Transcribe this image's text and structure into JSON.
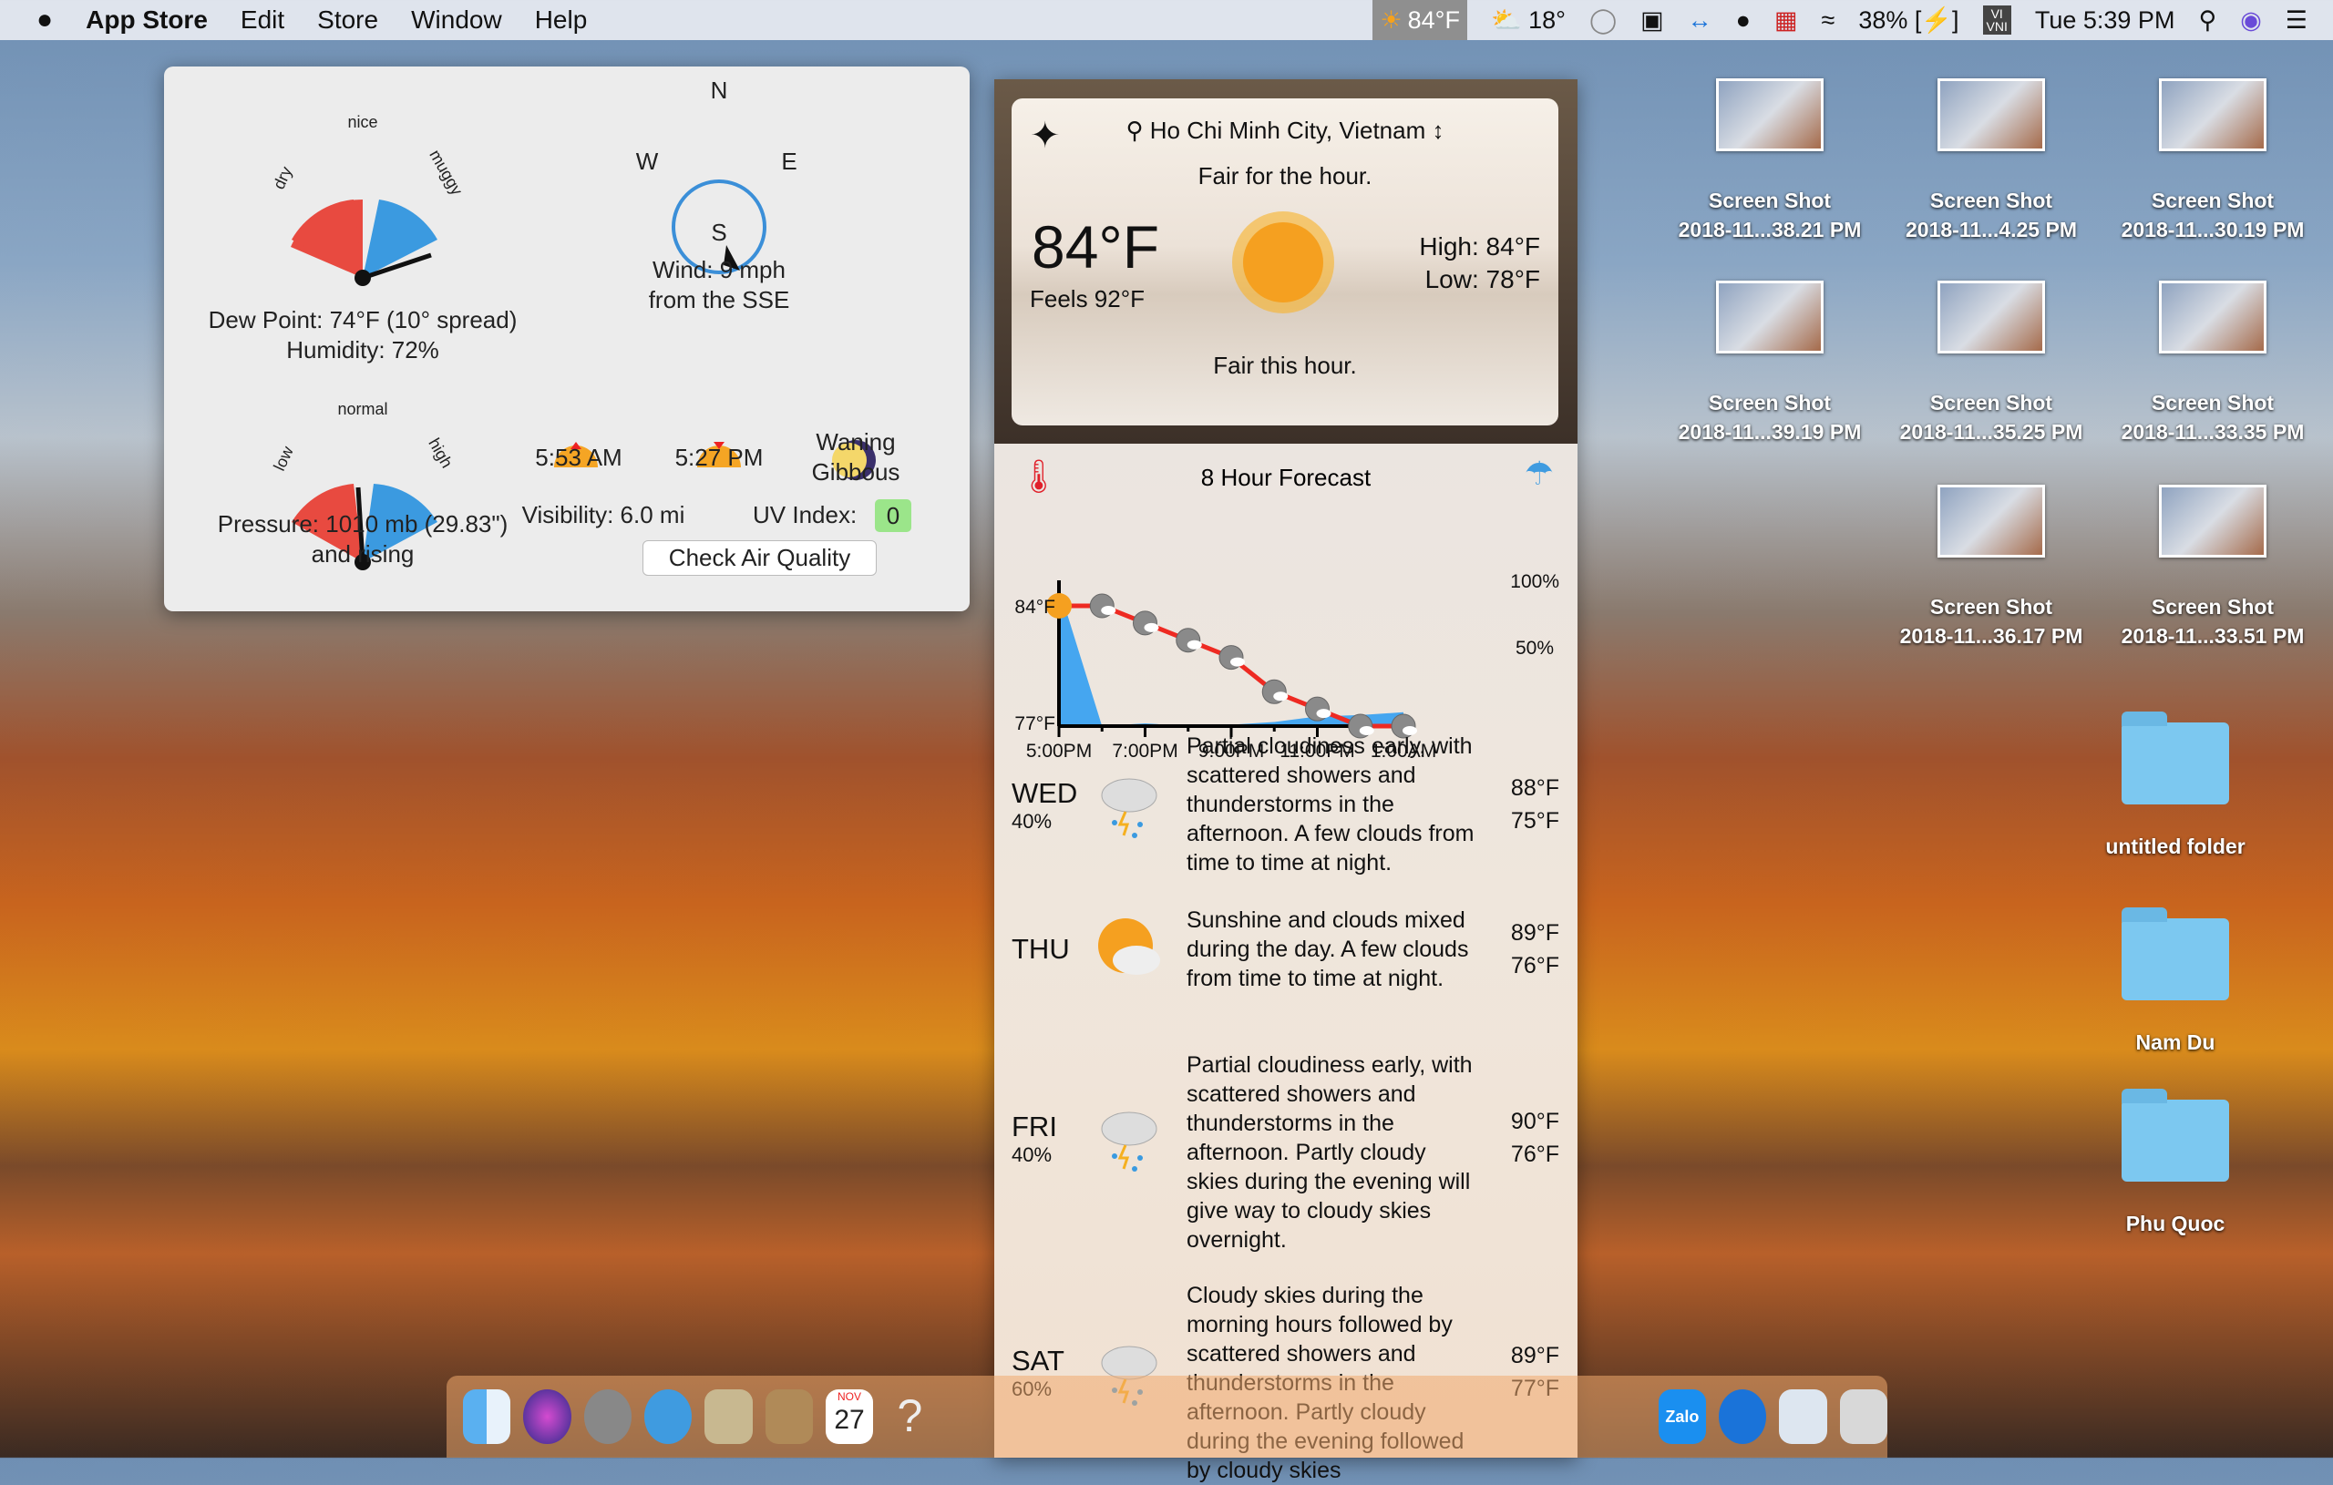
{
  "menubar": {
    "app": "App Store",
    "items": [
      "Edit",
      "Store",
      "Window",
      "Help"
    ],
    "weather_temp": "84°F",
    "secondary_temp": "18°",
    "battery": "38%",
    "input_method_top": "VI",
    "input_method_bottom": "VNI",
    "clock": "Tue 5:39 PM"
  },
  "popover": {
    "dew": {
      "label_nice": "nice",
      "label_dry": "dry",
      "label_muggy": "muggy",
      "line1": "Dew Point: 74°F (10° spread)",
      "line2": "Humidity: 72%"
    },
    "compass": {
      "n": "N",
      "s": "S",
      "e": "E",
      "w": "W",
      "line1": "Wind: 9 mph",
      "line2": "from the SSE"
    },
    "pressure": {
      "label_normal": "normal",
      "label_low": "low",
      "label_high": "high",
      "line1": "Pressure: 1010 mb (29.83\")",
      "line2": "and rising"
    },
    "sunrise": "5:53 AM",
    "sunset": "5:27 PM",
    "moon_line1": "Waning",
    "moon_line2": "Gibbous",
    "visibility": "Visibility: 6.0 mi",
    "uv_label": "UV Index:",
    "uv_value": "0",
    "air_quality_button": "Check Air Quality"
  },
  "current": {
    "location": "Ho Chi Minh City, Vietnam",
    "summary_hour": "Fair for the hour.",
    "temp": "84°F",
    "feels": "Feels 92°F",
    "high_label": "High:",
    "high": "84°F",
    "low_label": "Low:",
    "low": "78°F",
    "summary": "Fair this hour."
  },
  "chart_data": {
    "type": "line",
    "title": "8 Hour Forecast",
    "x": [
      "5:00PM",
      "6:00PM",
      "7:00PM",
      "8:00PM",
      "9:00PM",
      "10:00PM",
      "11:00PM",
      "12:00AM",
      "1:00AM"
    ],
    "xtick_labels": [
      "5:00PM",
      "7:00PM",
      "9:00PM",
      "11:00PM",
      "1:00AM"
    ],
    "series": [
      {
        "axis": "left",
        "values": [
          84,
          84,
          83,
          82,
          81,
          79,
          78,
          77,
          77
        ],
        "color": "#ee2a22"
      },
      {
        "axis": "right",
        "type": "area",
        "values": [
          100,
          0,
          2,
          0,
          1,
          3,
          7,
          8,
          10
        ],
        "color": "#45a6f0"
      }
    ],
    "ylim_left": [
      77,
      84
    ],
    "ytick_left": [
      "84°F",
      "77°F"
    ],
    "ylim_right": [
      0,
      100
    ],
    "ytick_right": [
      "100%",
      "50%"
    ]
  },
  "forecast": [
    {
      "day": "WED",
      "pop": "40%",
      "desc": "Partial cloudiness early, with scattered showers and thunderstorms in the afternoon. A few clouds from time to time at night.",
      "hi": "88°F",
      "lo": "75°F",
      "icon": "thunderstorm-icon"
    },
    {
      "day": "THU",
      "pop": "",
      "desc": "Sunshine and clouds mixed during the day. A few clouds from time to time at night.",
      "hi": "89°F",
      "lo": "76°F",
      "icon": "partly-sunny-icon"
    },
    {
      "day": "FRI",
      "pop": "40%",
      "desc": "Partial cloudiness early, with scattered showers and thunderstorms in the afternoon. Partly cloudy skies during the evening will give way to cloudy skies overnight.",
      "hi": "90°F",
      "lo": "76°F",
      "icon": "thunderstorm-icon"
    },
    {
      "day": "SAT",
      "pop": "60%",
      "desc": "Cloudy skies during the morning hours followed by scattered showers and thunderstorms in the afternoon. Partly cloudy during the evening followed by cloudy skies",
      "hi": "89°F",
      "lo": "77°F",
      "icon": "thunderstorm-icon"
    }
  ],
  "desktop": {
    "shots": [
      {
        "l1": "Screen Shot",
        "l2": "2018-11...38.21 PM"
      },
      {
        "l1": "Screen Shot",
        "l2": "2018-11...4.25 PM"
      },
      {
        "l1": "Screen Shot",
        "l2": "2018-11...30.19 PM"
      },
      {
        "l1": "Screen Shot",
        "l2": "2018-11...39.19 PM"
      },
      {
        "l1": "Screen Shot",
        "l2": "2018-11...35.25 PM"
      },
      {
        "l1": "Screen Shot",
        "l2": "2018-11...33.35 PM"
      },
      {
        "l1": "Screen Shot",
        "l2": "2018-11...36.17 PM"
      },
      {
        "l1": "Screen Shot",
        "l2": "2018-11...33.51 PM"
      }
    ],
    "folders": [
      "untitled folder",
      "Nam Du",
      "Phu Quoc"
    ]
  },
  "dock": {
    "calendar_month": "NOV",
    "calendar_day": "27",
    "zalo": "Zalo"
  }
}
